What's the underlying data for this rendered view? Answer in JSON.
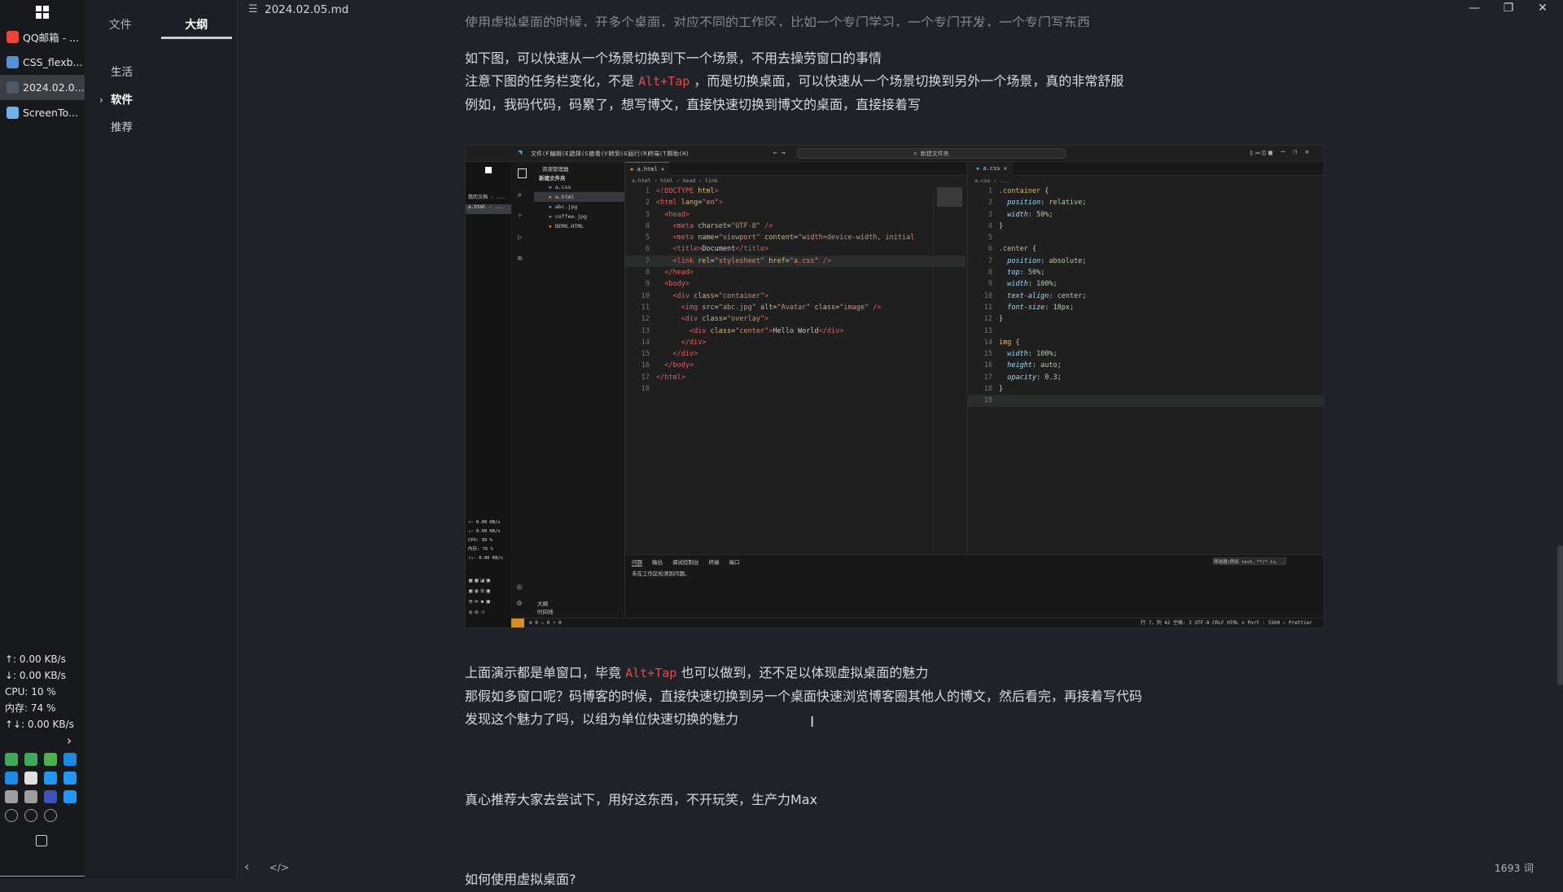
{
  "taskbar": {
    "items": [
      {
        "label": "QQ邮箱 - ...",
        "icon": "chrome-icon",
        "color": "#e8453c"
      },
      {
        "label": "CSS_flexb...",
        "icon": "document-icon",
        "color": "#5a8fd6"
      },
      {
        "label": "2024.02.0...",
        "icon": "typora-icon",
        "color": "#4f5a66"
      },
      {
        "label": "ScreenTo...",
        "icon": "screen-icon",
        "color": "#6fb1e8"
      }
    ],
    "stats": {
      "up": "↑: 0.00 KB/s",
      "down": "↓: 0.00 KB/s",
      "cpu": "CPU: 10 %",
      "mem": "内存: 74 %",
      "total": "↑↓: 0.00 KB/s"
    },
    "tray_icons": [
      "h-icon-1",
      "h-icon-2",
      "cloud-icon",
      "edge-icon",
      "app-icon",
      "globe-icon",
      "monitor-icon",
      "vscode-icon",
      "server-icon",
      "pointer-icon",
      "bluetooth-icon",
      "lightning-icon",
      "bag-icon",
      "shield-icon",
      "mute-icon"
    ]
  },
  "sidebar": {
    "tabs": [
      {
        "label": "文件",
        "active": false
      },
      {
        "label": "大纲",
        "active": true
      }
    ],
    "outline": [
      {
        "label": "生活",
        "expanded": false
      },
      {
        "label": "软件",
        "expanded": true
      },
      {
        "label": "推荐",
        "expanded": false
      }
    ]
  },
  "titlebar": {
    "title": "2024.02.05.md",
    "minimize": "—",
    "restore": "❐",
    "close": "✕"
  },
  "content": {
    "top_cut": "使用虚拟桌面的时候，开多个桌面，对应不同的工作区，比如一个专门学习，一个专门开发，一个专门写东西",
    "p1_line1": "如下图，可以快速从一个场景切换到下一个场景，不用去操劳窗口的事情",
    "p1_line2_a": "注意下图的任务栏变化，不是 ",
    "p1_line2_code": "Alt+Tap",
    "p1_line2_b": " ，而是切换桌面，可以快速从一个场景切换到另外一个场景，真的非常舒服",
    "p1_line3": "例如，我码代码，码累了，想写博文，直接快速切换到博文的桌面，直接接着写",
    "p2_line1_a": "上面演示都是单窗口，毕竟 ",
    "p2_line1_code": "Alt+Tap",
    "p2_line1_b": " 也可以做到，还不足以体现虚拟桌面的魅力",
    "p2_line2": "那假如多窗口呢？码博客的时候，直接快速切换到另一个桌面快速浏览博客圈其他人的博文，然后看完，再接着写代码",
    "p2_line3": "发现这个魅力了吗，以组为单位快速切换的魅力",
    "p3": "真心推荐大家去尝试下，用好这东西，不开玩笑，生产力Max",
    "next_heading": "如何使用虚拟桌面?"
  },
  "screenshot": {
    "menu": [
      "文件(F)",
      "编辑(E)",
      "选择(S)",
      "查看(V)",
      "转到(G)",
      "运行(R)",
      "终端(T)",
      "帮助(H)"
    ],
    "search": "⌕ 新建文件夹",
    "explorer_title": "资源管理器",
    "explorer_folder": "新建文件夹",
    "files": [
      "a.css",
      "a.html",
      "abc.jpg",
      "coffee.jpg",
      "DEMO.HTML"
    ],
    "tab_left": "a.html",
    "tab_right": "a.css",
    "crumb_left": "a.html › html › head › link",
    "crumb_right": "a.css › ...",
    "inner_stats": [
      "↑: 0.00 KB/s",
      "↓: 0.00 KB/s",
      "CPU: 30 %",
      "内存: 76 %",
      "↑↓: 0.00 KB/s"
    ],
    "inner_task": [
      "我的文档 - ...",
      "a.html - ..."
    ],
    "panel_tabs": [
      "问题",
      "输出",
      "调试控制台",
      "终端",
      "端口"
    ],
    "panel_msg": "未在工作区检测到问题。",
    "panel_filter": "筛选器(例如 text、**/*.ts、...)",
    "outline_items": [
      "大纲",
      "时间线"
    ],
    "status_left": "⊗ 0 ⚠ 0   ⚡ 0",
    "status_right": "行 7，列 42   空格: 2   UTF-8   CRLF   HTML   ⊙ Port : 5500   ✓ Prettier",
    "html_lines": [
      [
        [
          "t-tag",
          "<!DOCTYPE"
        ],
        [
          "t-txt",
          " "
        ],
        [
          "t-attr",
          "html"
        ],
        [
          "t-tag",
          ">"
        ]
      ],
      [
        [
          "t-tag",
          "<html "
        ],
        [
          "t-attr",
          "lang"
        ],
        [
          "t-txt",
          "="
        ],
        [
          "t-str",
          "\"en\""
        ],
        [
          "t-tag",
          ">"
        ]
      ],
      [
        [
          "t-txt",
          "  "
        ],
        [
          "t-tag",
          "<head>"
        ]
      ],
      [
        [
          "t-txt",
          "    "
        ],
        [
          "t-tag",
          "<meta "
        ],
        [
          "t-attr",
          "charset"
        ],
        [
          "t-txt",
          "="
        ],
        [
          "t-str",
          "\"UTF-8\""
        ],
        [
          "t-txt",
          " "
        ],
        [
          "t-tag",
          "/>"
        ]
      ],
      [
        [
          "t-txt",
          "    "
        ],
        [
          "t-tag",
          "<meta "
        ],
        [
          "t-attr",
          "name"
        ],
        [
          "t-txt",
          "="
        ],
        [
          "t-str",
          "\"viewport\""
        ],
        [
          "t-txt",
          " "
        ],
        [
          "t-attr",
          "content"
        ],
        [
          "t-txt",
          "="
        ],
        [
          "t-str",
          "\"width=device-width, initial"
        ]
      ],
      [
        [
          "t-txt",
          "    "
        ],
        [
          "t-tag",
          "<title>"
        ],
        [
          "t-txt",
          "Document"
        ],
        [
          "t-tag",
          "</title>"
        ]
      ],
      [
        [
          "t-txt",
          "    "
        ],
        [
          "t-tag",
          "<link "
        ],
        [
          "t-attr",
          "rel"
        ],
        [
          "t-txt",
          "="
        ],
        [
          "t-str",
          "\"stylesheet\""
        ],
        [
          "t-txt",
          " "
        ],
        [
          "t-attr",
          "href"
        ],
        [
          "t-txt",
          "="
        ],
        [
          "t-str",
          "\"a.css\""
        ],
        [
          "t-txt",
          " "
        ],
        [
          "t-tag",
          "/>"
        ]
      ],
      [
        [
          "t-txt",
          "  "
        ],
        [
          "t-tag",
          "</head>"
        ]
      ],
      [
        [
          "t-txt",
          "  "
        ],
        [
          "t-tag",
          "<body>"
        ]
      ],
      [
        [
          "t-txt",
          "    "
        ],
        [
          "t-tag",
          "<div "
        ],
        [
          "t-attr",
          "class"
        ],
        [
          "t-txt",
          "="
        ],
        [
          "t-str",
          "\"container\""
        ],
        [
          "t-tag",
          ">"
        ]
      ],
      [
        [
          "t-txt",
          "      "
        ],
        [
          "t-tag",
          "<img "
        ],
        [
          "t-attr",
          "src"
        ],
        [
          "t-txt",
          "="
        ],
        [
          "t-str",
          "\"abc.jpg\""
        ],
        [
          "t-txt",
          " "
        ],
        [
          "t-attr",
          "alt"
        ],
        [
          "t-txt",
          "="
        ],
        [
          "t-str",
          "\"Avatar\""
        ],
        [
          "t-txt",
          " "
        ],
        [
          "t-attr",
          "class"
        ],
        [
          "t-txt",
          "="
        ],
        [
          "t-str",
          "\"image\""
        ],
        [
          "t-txt",
          " "
        ],
        [
          "t-tag",
          "/>"
        ]
      ],
      [
        [
          "t-txt",
          "      "
        ],
        [
          "t-tag",
          "<div "
        ],
        [
          "t-attr",
          "class"
        ],
        [
          "t-txt",
          "="
        ],
        [
          "t-str",
          "\"overlay\""
        ],
        [
          "t-tag",
          ">"
        ]
      ],
      [
        [
          "t-txt",
          "        "
        ],
        [
          "t-tag",
          "<div "
        ],
        [
          "t-attr",
          "class"
        ],
        [
          "t-txt",
          "="
        ],
        [
          "t-str",
          "\"center\""
        ],
        [
          "t-tag",
          ">"
        ],
        [
          "t-txt",
          "Hello World"
        ],
        [
          "t-tag",
          "</div>"
        ]
      ],
      [
        [
          "t-txt",
          "      "
        ],
        [
          "t-tag",
          "</div>"
        ]
      ],
      [
        [
          "t-txt",
          "    "
        ],
        [
          "t-tag",
          "</div>"
        ]
      ],
      [
        [
          "t-txt",
          "  "
        ],
        [
          "t-tag",
          "</body>"
        ]
      ],
      [
        [
          "t-tag",
          "</html>"
        ]
      ],
      []
    ],
    "css_lines": [
      [
        [
          "t-sel",
          ".container"
        ],
        [
          "t-txt",
          " {"
        ]
      ],
      [
        [
          "t-txt",
          "  "
        ],
        [
          "t-prop",
          "position"
        ],
        [
          "t-txt",
          ": "
        ],
        [
          "t-val",
          "relative"
        ],
        [
          "t-txt",
          ";"
        ]
      ],
      [
        [
          "t-txt",
          "  "
        ],
        [
          "t-prop",
          "width"
        ],
        [
          "t-txt",
          ": "
        ],
        [
          "t-val",
          "50%"
        ],
        [
          "t-txt",
          ";"
        ]
      ],
      [
        [
          "t-txt",
          "}"
        ]
      ],
      [],
      [
        [
          "t-sel",
          ".center"
        ],
        [
          "t-txt",
          " {"
        ]
      ],
      [
        [
          "t-txt",
          "  "
        ],
        [
          "t-prop",
          "position"
        ],
        [
          "t-txt",
          ": "
        ],
        [
          "t-val",
          "absolute"
        ],
        [
          "t-txt",
          ";"
        ]
      ],
      [
        [
          "t-txt",
          "  "
        ],
        [
          "t-prop",
          "top"
        ],
        [
          "t-txt",
          ": "
        ],
        [
          "t-val",
          "50%"
        ],
        [
          "t-txt",
          ";"
        ]
      ],
      [
        [
          "t-txt",
          "  "
        ],
        [
          "t-prop",
          "width"
        ],
        [
          "t-txt",
          ": "
        ],
        [
          "t-val",
          "100%"
        ],
        [
          "t-txt",
          ";"
        ]
      ],
      [
        [
          "t-txt",
          "  "
        ],
        [
          "t-prop",
          "text-align"
        ],
        [
          "t-txt",
          ": "
        ],
        [
          "t-val",
          "center"
        ],
        [
          "t-txt",
          ";"
        ]
      ],
      [
        [
          "t-txt",
          "  "
        ],
        [
          "t-prop",
          "font-size"
        ],
        [
          "t-txt",
          ": "
        ],
        [
          "t-val",
          "18px"
        ],
        [
          "t-txt",
          ";"
        ]
      ],
      [
        [
          "t-txt",
          "}"
        ]
      ],
      [],
      [
        [
          "t-sel",
          "img"
        ],
        [
          "t-txt",
          " {"
        ]
      ],
      [
        [
          "t-txt",
          "  "
        ],
        [
          "t-prop",
          "width"
        ],
        [
          "t-txt",
          ": "
        ],
        [
          "t-val",
          "100%"
        ],
        [
          "t-txt",
          ";"
        ]
      ],
      [
        [
          "t-txt",
          "  "
        ],
        [
          "t-prop",
          "height"
        ],
        [
          "t-txt",
          ": "
        ],
        [
          "t-val",
          "auto"
        ],
        [
          "t-txt",
          ";"
        ]
      ],
      [
        [
          "t-txt",
          "  "
        ],
        [
          "t-prop",
          "opacity"
        ],
        [
          "t-txt",
          ": "
        ],
        [
          "t-val",
          "0.3"
        ],
        [
          "t-txt",
          ";"
        ]
      ],
      [
        [
          "t-txt",
          "}"
        ]
      ],
      []
    ]
  },
  "footer": {
    "back": "‹",
    "source_mode": "</>",
    "word_count": "1693 词"
  }
}
